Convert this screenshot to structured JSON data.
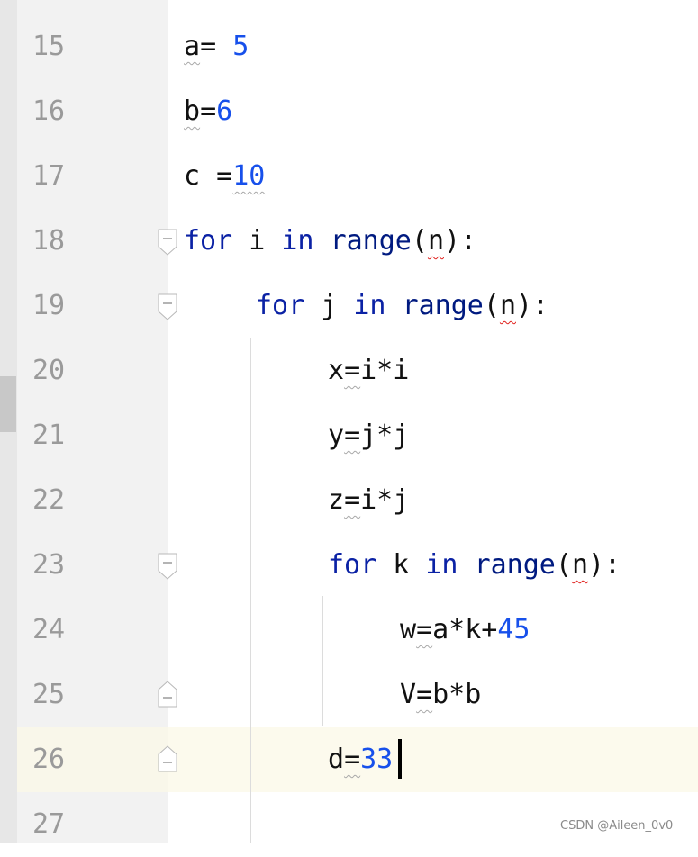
{
  "editor": {
    "current_line": 26,
    "lines": [
      {
        "number": "15",
        "tokens": [
          {
            "text": "a",
            "kind": "plain",
            "underline": "gray"
          },
          {
            "text": "= ",
            "kind": "plain"
          },
          {
            "text": "5",
            "kind": "num"
          }
        ]
      },
      {
        "number": "16",
        "tokens": [
          {
            "text": "b",
            "kind": "plain",
            "underline": "gray"
          },
          {
            "text": "=",
            "kind": "plain"
          },
          {
            "text": "6",
            "kind": "num"
          }
        ]
      },
      {
        "number": "17",
        "tokens": [
          {
            "text": "c ",
            "kind": "plain"
          },
          {
            "text": "=",
            "kind": "plain"
          },
          {
            "text": "10",
            "kind": "num",
            "underline": "gray"
          }
        ]
      },
      {
        "number": "18",
        "tokens": [
          {
            "text": "for",
            "kind": "kw"
          },
          {
            "text": " i ",
            "kind": "plain"
          },
          {
            "text": "in",
            "kind": "kw"
          },
          {
            "text": " ",
            "kind": "plain"
          },
          {
            "text": "range",
            "kind": "fn"
          },
          {
            "text": "(",
            "kind": "plain"
          },
          {
            "text": "n",
            "kind": "plain",
            "underline": "red"
          },
          {
            "text": "):",
            "kind": "plain"
          }
        ]
      },
      {
        "number": "19",
        "tokens": [
          {
            "text": "for",
            "kind": "kw"
          },
          {
            "text": " j ",
            "kind": "plain"
          },
          {
            "text": "in",
            "kind": "kw"
          },
          {
            "text": " ",
            "kind": "plain"
          },
          {
            "text": "range",
            "kind": "fn"
          },
          {
            "text": "(",
            "kind": "plain"
          },
          {
            "text": "n",
            "kind": "plain",
            "underline": "red"
          },
          {
            "text": "):",
            "kind": "plain"
          }
        ]
      },
      {
        "number": "20",
        "tokens": [
          {
            "text": "x",
            "kind": "plain"
          },
          {
            "text": "=",
            "kind": "plain",
            "underline": "gray"
          },
          {
            "text": "i*i",
            "kind": "plain"
          }
        ]
      },
      {
        "number": "21",
        "tokens": [
          {
            "text": "y",
            "kind": "plain"
          },
          {
            "text": "=",
            "kind": "plain",
            "underline": "gray"
          },
          {
            "text": "j*j",
            "kind": "plain"
          }
        ]
      },
      {
        "number": "22",
        "tokens": [
          {
            "text": "z",
            "kind": "plain"
          },
          {
            "text": "=",
            "kind": "plain",
            "underline": "gray"
          },
          {
            "text": "i*j",
            "kind": "plain"
          }
        ]
      },
      {
        "number": "23",
        "tokens": [
          {
            "text": "for",
            "kind": "kw"
          },
          {
            "text": " k ",
            "kind": "plain"
          },
          {
            "text": "in",
            "kind": "kw"
          },
          {
            "text": " ",
            "kind": "plain"
          },
          {
            "text": "range",
            "kind": "fn"
          },
          {
            "text": "(",
            "kind": "plain"
          },
          {
            "text": "n",
            "kind": "plain",
            "underline": "red"
          },
          {
            "text": "):",
            "kind": "plain"
          }
        ]
      },
      {
        "number": "24",
        "tokens": [
          {
            "text": "w",
            "kind": "plain"
          },
          {
            "text": "=",
            "kind": "plain",
            "underline": "gray"
          },
          {
            "text": "a*k+",
            "kind": "plain"
          },
          {
            "text": "45",
            "kind": "num"
          }
        ]
      },
      {
        "number": "25",
        "tokens": [
          {
            "text": "V",
            "kind": "plain"
          },
          {
            "text": "=",
            "kind": "plain",
            "underline": "gray"
          },
          {
            "text": "b*b",
            "kind": "plain"
          }
        ]
      },
      {
        "number": "26",
        "tokens": [
          {
            "text": "d",
            "kind": "plain"
          },
          {
            "text": "=",
            "kind": "plain",
            "underline": "gray"
          },
          {
            "text": "33",
            "kind": "num"
          }
        ]
      },
      {
        "number": "27",
        "tokens": []
      }
    ]
  },
  "colors": {
    "keyword": "#0b22a5",
    "builtin": "#001a80",
    "number": "#1750eb",
    "warning_underline": "#a8a8a8",
    "error_underline": "#e0201c",
    "current_line_highlight": "#fcfaed"
  },
  "watermark": "CSDN @Aileen_0v0"
}
